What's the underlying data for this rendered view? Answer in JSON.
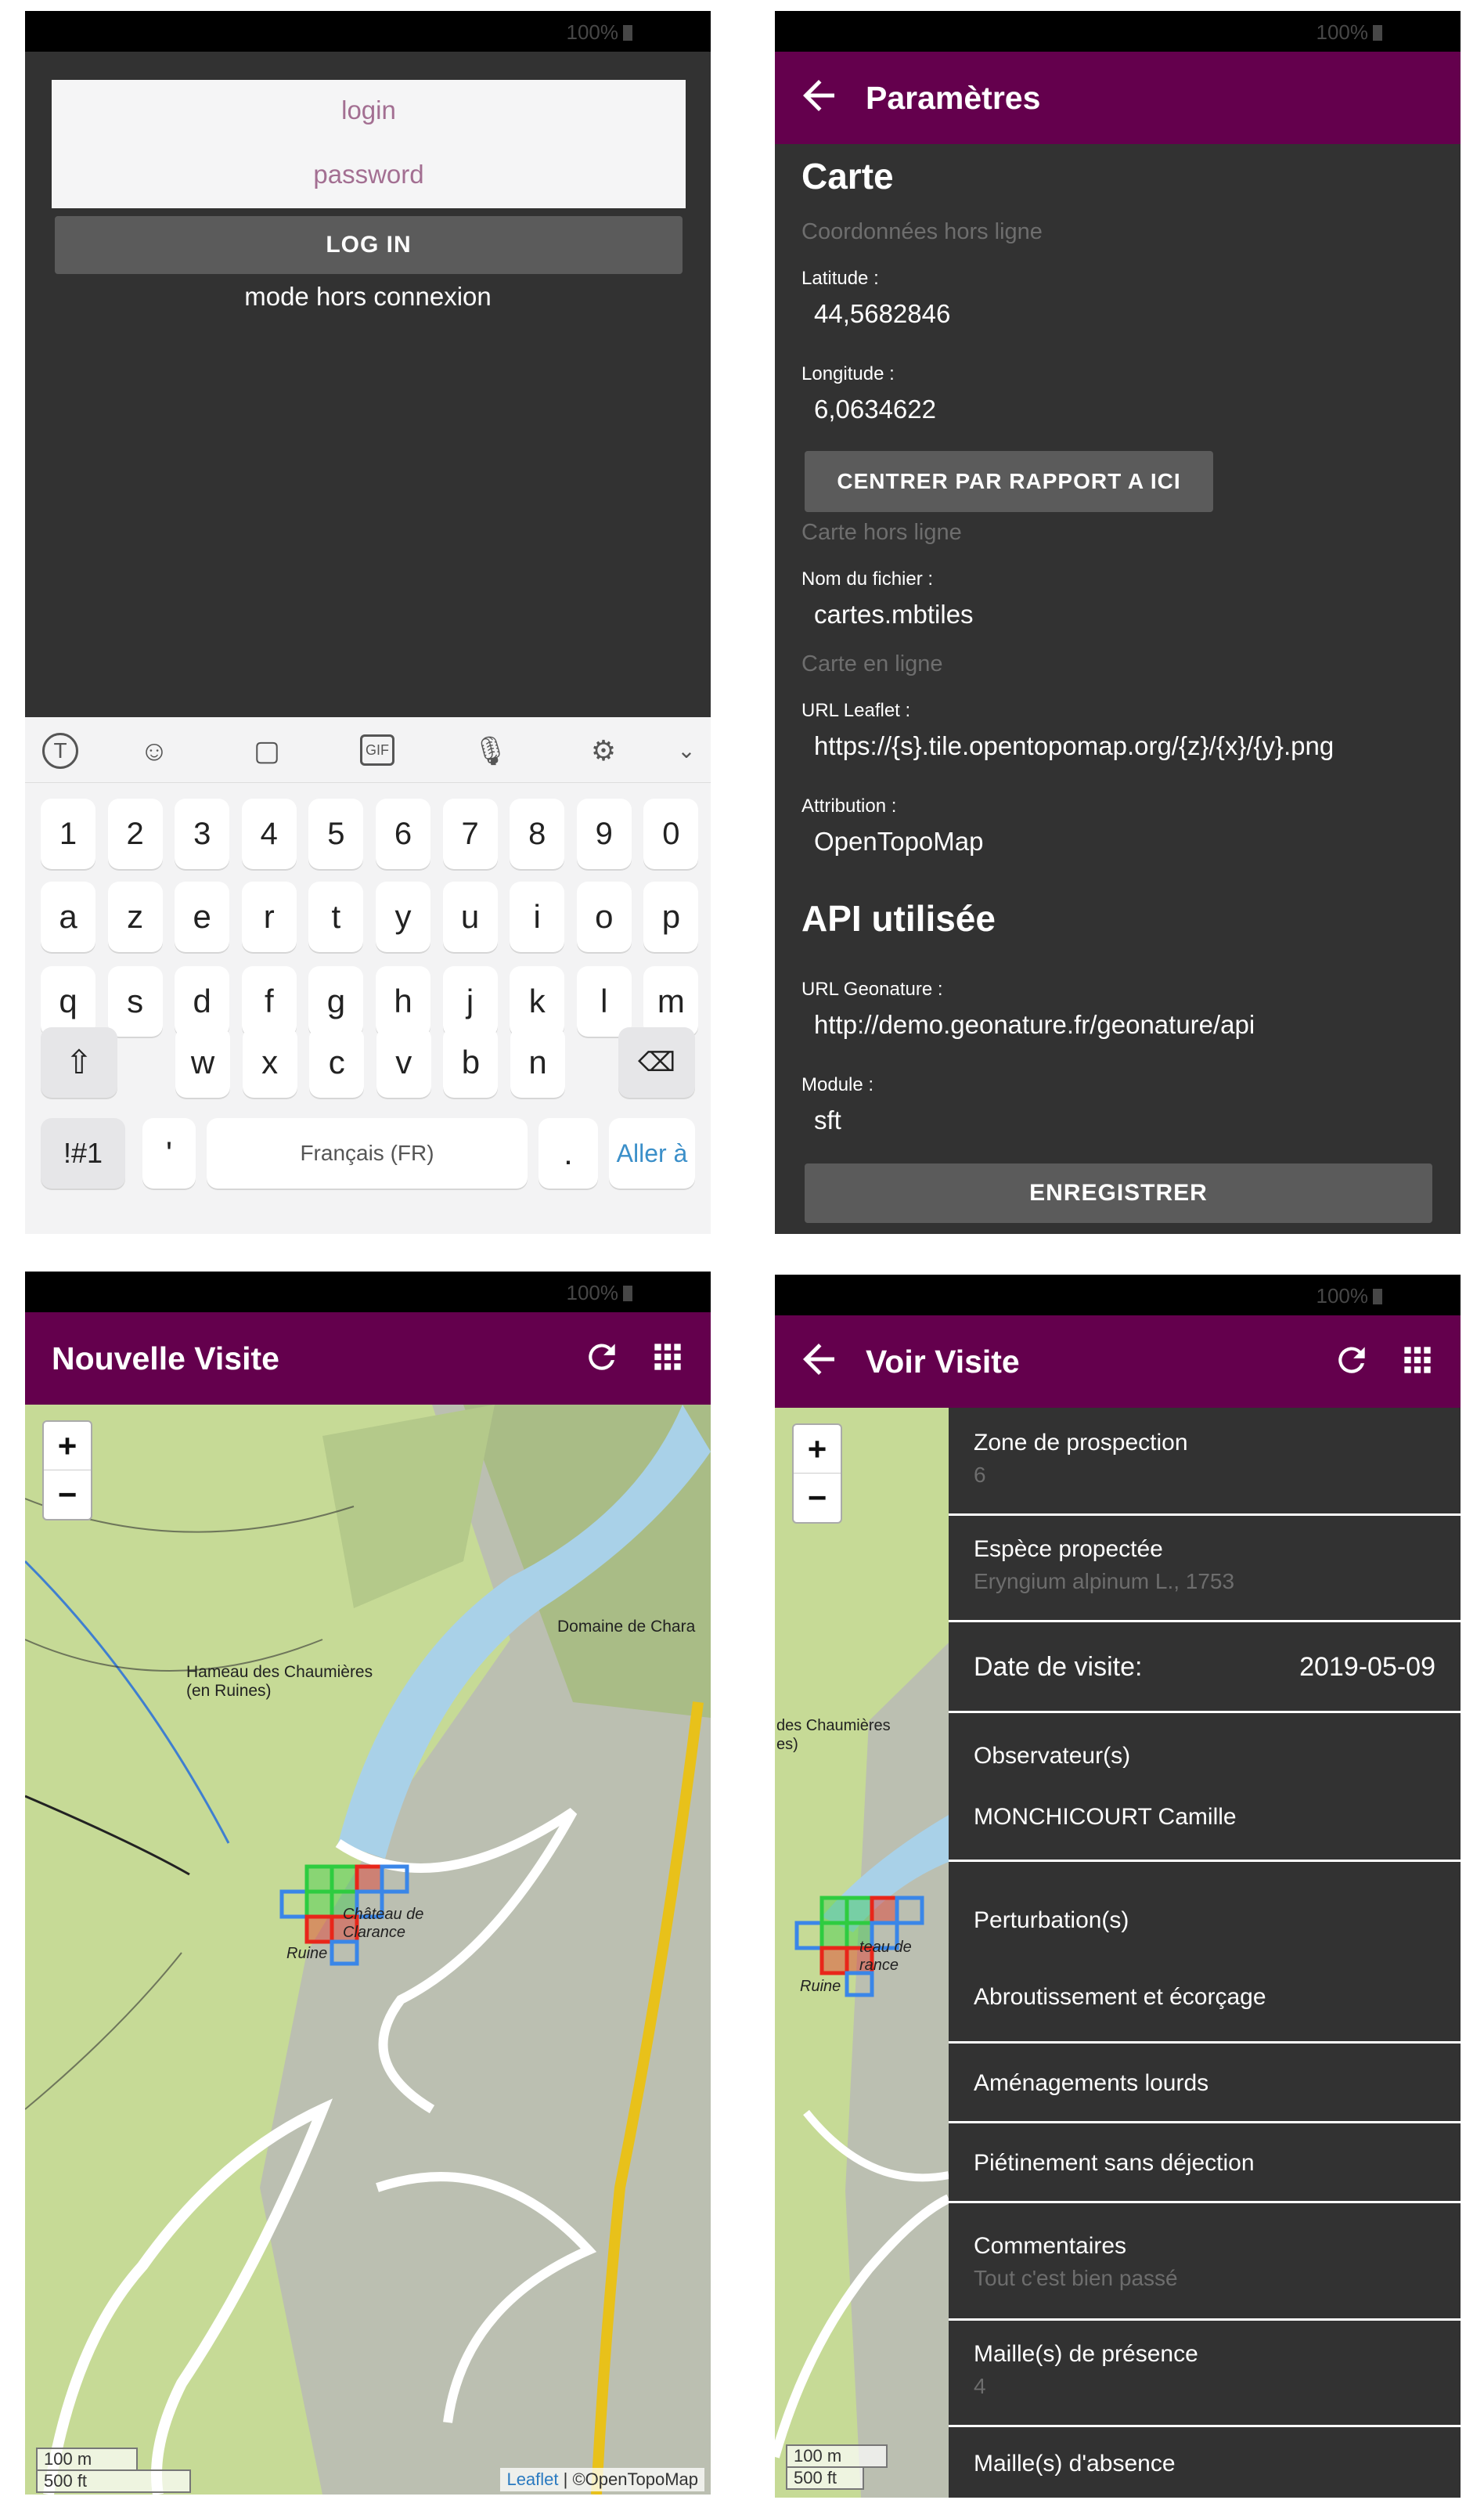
{
  "status_bar": {
    "battery": "100%"
  },
  "login": {
    "login_placeholder": "login",
    "password_placeholder": "password",
    "login_button": "LOG IN",
    "offline_mode": "mode hors connexion"
  },
  "keyboard": {
    "row1": [
      "1",
      "2",
      "3",
      "4",
      "5",
      "6",
      "7",
      "8",
      "9",
      "0"
    ],
    "row2": [
      "a",
      "z",
      "e",
      "r",
      "t",
      "y",
      "u",
      "i",
      "o",
      "p"
    ],
    "row3": [
      "q",
      "s",
      "d",
      "f",
      "g",
      "h",
      "j",
      "k",
      "l",
      "m"
    ],
    "row4": [
      "w",
      "x",
      "c",
      "v",
      "b",
      "n"
    ],
    "symbols": "!#1",
    "apostrophe": "'",
    "space": "Français (FR)",
    "period": ".",
    "go": "Aller à"
  },
  "settings": {
    "title": "Paramètres",
    "map_header": "Carte",
    "offline_coords": "Coordonnées hors ligne",
    "latitude_label": "Latitude :",
    "latitude": "44,5682846",
    "longitude_label": "Longitude :",
    "longitude": "6,0634622",
    "center_button": "CENTRER PAR RAPPORT A ICI",
    "offline_map": "Carte hors ligne",
    "filename_label": "Nom du fichier :",
    "filename": "cartes.mbtiles",
    "online_map": "Carte en ligne",
    "leaflet_label": "URL Leaflet :",
    "leaflet_url": "https://{s}.tile.opentopomap.org/{z}/{x}/{y}.png",
    "attribution_label": "Attribution :",
    "attribution": "OpenTopoMap",
    "api_header": "API utilisée",
    "geonature_label": "URL Geonature :",
    "geonature_url": "http://demo.geonature.fr/geonature/api",
    "module_label": "Module :",
    "module": "sft",
    "save_button": "ENREGISTRER"
  },
  "nouvelle_visite": {
    "title": "Nouvelle Visite"
  },
  "map": {
    "zoom_in": "+",
    "zoom_out": "−",
    "label_hameau": "Hameau des Chaumières\n(en Ruines)",
    "label_domaine": "Domaine de Chara",
    "label_chateau": "Château de\nClarance",
    "label_chateau_partial": "teau de\nrance",
    "label_ruine": "Ruine",
    "label_hameau_partial": "des Chaumières\nes)",
    "scale_m": "100 m",
    "scale_ft": "500 ft",
    "attribution_link": "Leaflet",
    "attribution_text": " | ©OpenTopoMap"
  },
  "voir_visite": {
    "title": "Voir Visite",
    "zone_label": "Zone de prospection",
    "zone_value": "6",
    "espece_label": "Espèce propectée",
    "espece_value": "Eryngium alpinum L., 1753",
    "date_label": "Date de visite:",
    "date_value": "2019-05-09",
    "observateurs_label": "Observateur(s)",
    "observateur": "MONCHICOURT Camille",
    "perturbations_label": "Perturbation(s)",
    "perturbations": [
      "Abroutissement et écorçage",
      "Aménagements lourds",
      "Piétinement sans déjection"
    ],
    "commentaires_label": "Commentaires",
    "commentaires_value": "Tout c'est bien passé",
    "presence_label": "Maille(s) de présence",
    "presence_value": "4",
    "absence_label": "Maille(s) d'absence"
  },
  "colors": {
    "appbar": "#64004d",
    "background": "#323232",
    "presence": "#2ecc40",
    "absence": "#e8261a",
    "grid_blue": "#3a86e8"
  }
}
